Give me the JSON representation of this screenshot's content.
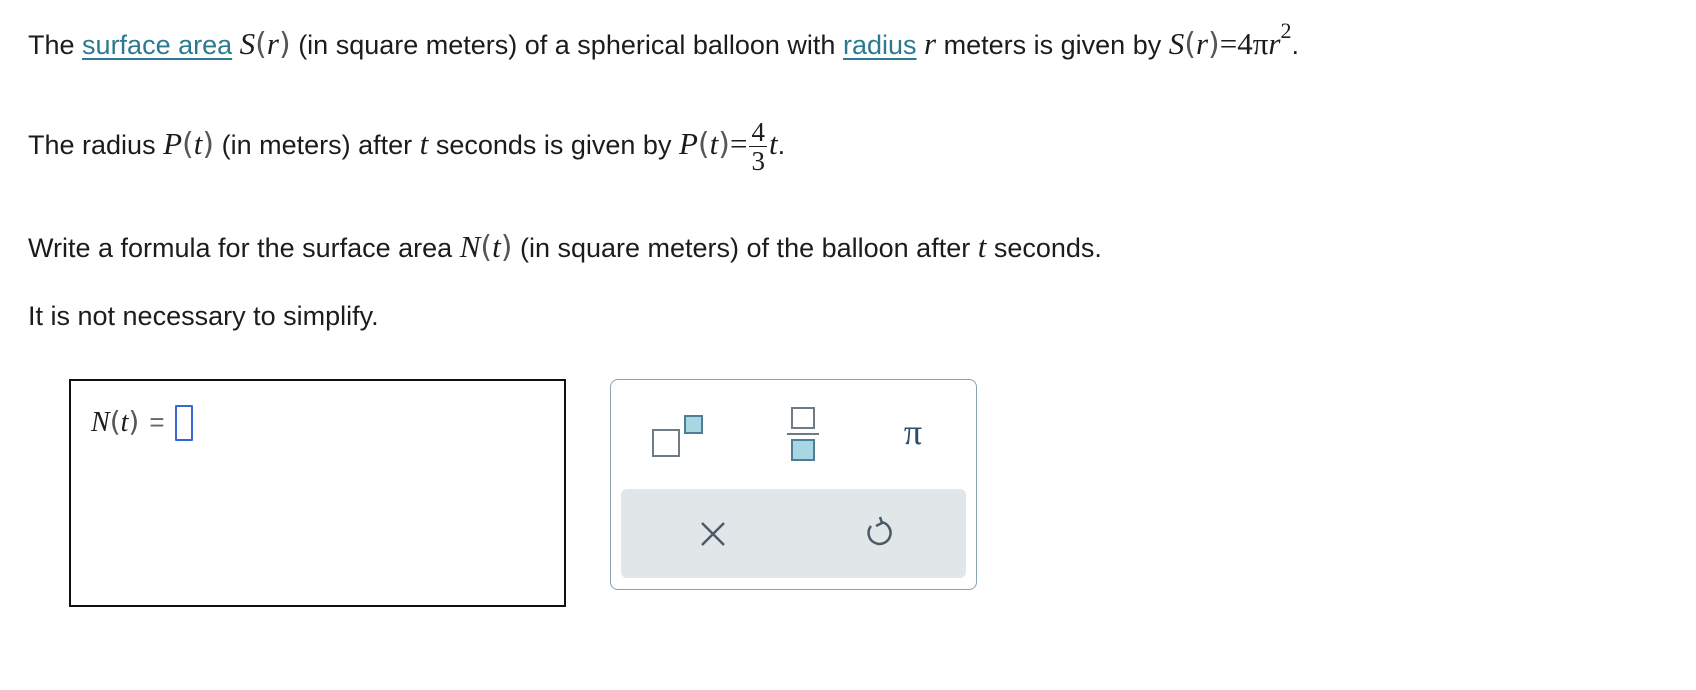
{
  "line1": {
    "t1": "The",
    "link1": "surface area",
    "fn": "S",
    "var": "r",
    "t2": "(in square meters) of a spherical balloon with",
    "link2": "radius",
    "var2": "r",
    "t3": "meters is given by",
    "fn2": "S",
    "var3": "r",
    "eq": "=",
    "coef": "4π",
    "var4": "r",
    "exp": "2",
    "end": "."
  },
  "line2": {
    "t1": "The radius",
    "fn": "P",
    "var": "t",
    "t2": "(in meters) after",
    "var2": "t",
    "t3": "seconds is given by",
    "fn2": "P",
    "var3": "t",
    "eq": "=",
    "num": "4",
    "den": "3",
    "var4": "t",
    "end": "."
  },
  "line3": {
    "t1": "Write a formula for the surface area",
    "fn": "N",
    "var": "t",
    "t2": "(in square meters) of the balloon after",
    "var2": "t",
    "t3": "seconds."
  },
  "line4": {
    "text": "It is not necessary to simplify."
  },
  "answer": {
    "fn": "N",
    "var": "t",
    "eq": "="
  },
  "palette": {
    "exponent_tool": "exponent-icon",
    "fraction_tool": "fraction-icon",
    "pi_tool": "π",
    "clear_tool": "clear-icon",
    "undo_tool": "undo-icon"
  },
  "colors": {
    "link": "#2b7a8f",
    "cursor": "#3a67d8",
    "palette_border": "#8aa3b3",
    "palette_bottom": "#e1e6e9"
  }
}
